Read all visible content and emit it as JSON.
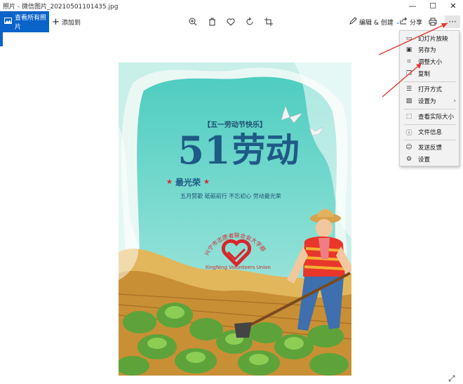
{
  "window": {
    "title": "照片 - 微信图片_20210501101435.jpg",
    "minimize": "—",
    "maximize": "☐",
    "close": "✕"
  },
  "toolbar": {
    "view_all": "查看所有照片",
    "add_to": "添加到",
    "edit_create": "编辑 & 创建",
    "share": "分享",
    "more": "···"
  },
  "menu": {
    "items": [
      {
        "icon": "slideshow-icon",
        "label": "幻灯片放映"
      },
      {
        "icon": "save-icon",
        "label": "另存为"
      },
      {
        "icon": "resize-icon",
        "label": "调整大小"
      },
      {
        "icon": "copy-icon",
        "label": "复制"
      },
      {
        "icon": "open-with-icon",
        "label": "打开方式"
      },
      {
        "icon": "set-as-icon",
        "label": "设置为"
      },
      {
        "icon": "actual-size-icon",
        "label": "查看实际大小"
      },
      {
        "icon": "info-icon",
        "label": "文件信息"
      },
      {
        "icon": "feedback-icon",
        "label": "发送反馈"
      },
      {
        "icon": "settings-icon",
        "label": "设置"
      }
    ]
  },
  "poster": {
    "banner": "【五一劳动节快乐】",
    "headline_num": "51",
    "headline_text": "劳动",
    "subtitle": "最光荣",
    "slogan": "五月赞歌 砥砺前行 不忘初心 劳动最光荣",
    "org_cn": "兴宁市志愿者联合会大学部",
    "org_en": "XingNing  Volunteers  Union"
  },
  "colors": {
    "accent": "#0a63c9",
    "poster_teal": "#5fd3c6",
    "headline": "#1e5a86",
    "red": "#d9262b"
  }
}
